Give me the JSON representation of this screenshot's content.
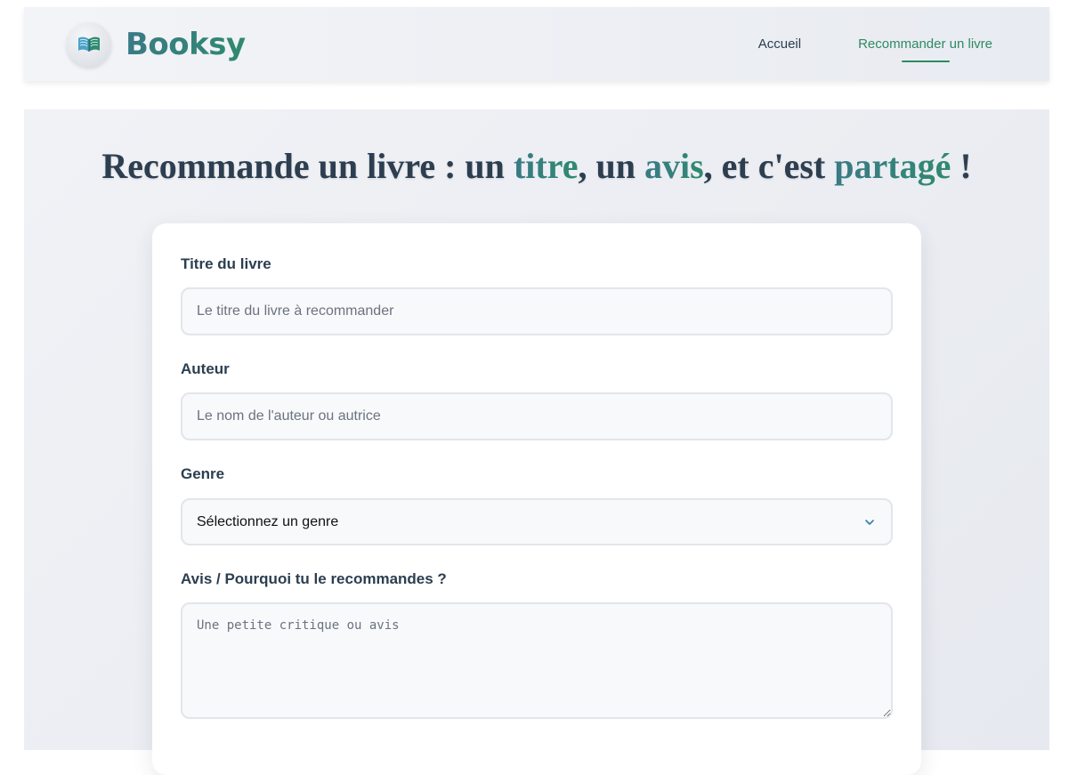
{
  "brand": {
    "logo_icon": "open-book-icon",
    "name": "Booksy",
    "accent_gradient": [
      "#3a7a86",
      "#2f8a70"
    ]
  },
  "nav": {
    "items": [
      {
        "label": "Accueil",
        "active": false
      },
      {
        "label": "Recommander un livre",
        "active": true
      }
    ],
    "active_color": "#2f8a62"
  },
  "page": {
    "title_parts": {
      "p1": "Recommande un livre : un ",
      "h1": "titre",
      "p2": ", un ",
      "h2": "avis",
      "p3": ", et c'est ",
      "h3": "partagé",
      "p4": " !"
    }
  },
  "form": {
    "title_field": {
      "label": "Titre du livre",
      "placeholder": "Le titre du livre à recommander",
      "value": ""
    },
    "author_field": {
      "label": "Auteur",
      "placeholder": "Le nom de l'auteur ou autrice",
      "value": ""
    },
    "genre_field": {
      "label": "Genre",
      "selected": "Sélectionnez un genre",
      "icon": "chevron-down-icon"
    },
    "review_field": {
      "label": "Avis / Pourquoi tu le recommandes ?",
      "placeholder": "Une petite critique ou avis",
      "value": ""
    }
  }
}
